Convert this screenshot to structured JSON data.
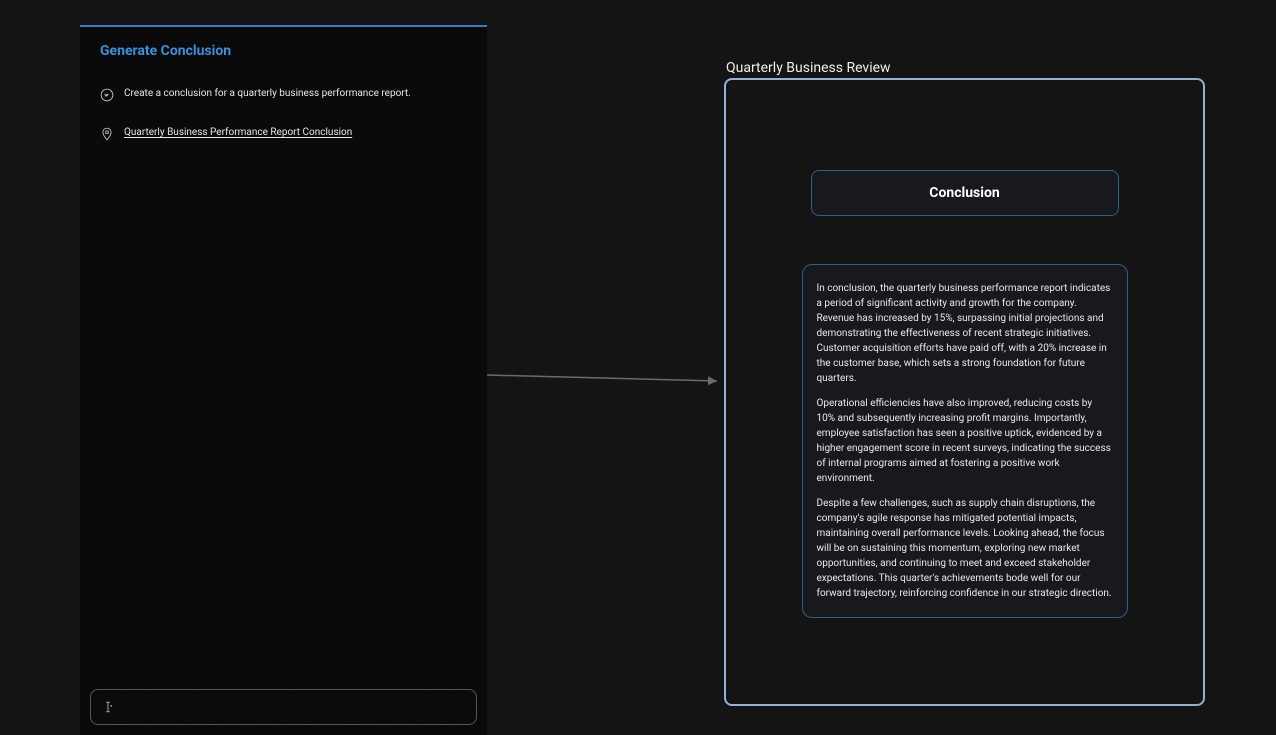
{
  "left": {
    "title": "Generate Conclusion",
    "messages": [
      {
        "icon": "user-circle-icon",
        "text": "Create a conclusion for a quarterly business performance report.",
        "link": false
      },
      {
        "icon": "location-pin-icon",
        "text": "Quarterly Business Performance Report Conclusion",
        "link": true
      }
    ],
    "input_placeholder": ""
  },
  "right": {
    "doc_title": "Quarterly Business Review",
    "section_heading": "Conclusion",
    "paragraphs": [
      "In conclusion, the quarterly business performance report indicates a period of significant activity and growth for the company. Revenue has increased by 15%, surpassing initial projections and demonstrating the effectiveness of recent strategic initiatives. Customer acquisition efforts have paid off, with a 20% increase in the customer base, which sets a strong foundation for future quarters.",
      "Operational efficiencies have also improved, reducing costs by 10% and subsequently increasing profit margins. Importantly, employee satisfaction has seen a positive uptick, evidenced by a higher engagement score in recent surveys, indicating the success of internal programs aimed at fostering a positive work environment.",
      "Despite a few challenges, such as supply chain disruptions, the company's agile response has mitigated potential impacts, maintaining overall performance levels. Looking ahead, the focus will be on sustaining this momentum, exploring new market opportunities, and continuing to meet and exceed stakeholder expectations. This quarter's achievements bode well for our forward trajectory, reinforcing confidence in our strategic direction."
    ]
  }
}
